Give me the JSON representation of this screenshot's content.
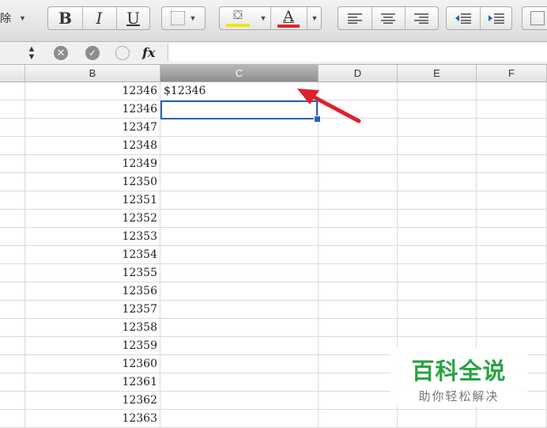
{
  "toolbar": {
    "clipped_label": "除",
    "bold_label": "B",
    "italic_label": "I",
    "underline_label": "U",
    "font_color_letter": "A",
    "fill_color_hex": "#f2e600",
    "font_color_hex": "#e0252b"
  },
  "formula_bar": {
    "fx_label": "fx",
    "content": ""
  },
  "columns": [
    "B",
    "C",
    "D",
    "E",
    "F"
  ],
  "selected_column": "C",
  "rows": [
    {
      "b": "12346",
      "c": "$12346"
    },
    {
      "b": "12346",
      "c": ""
    },
    {
      "b": "12347",
      "c": ""
    },
    {
      "b": "12348",
      "c": ""
    },
    {
      "b": "12349",
      "c": ""
    },
    {
      "b": "12350",
      "c": ""
    },
    {
      "b": "12351",
      "c": ""
    },
    {
      "b": "12352",
      "c": ""
    },
    {
      "b": "12353",
      "c": ""
    },
    {
      "b": "12354",
      "c": ""
    },
    {
      "b": "12355",
      "c": ""
    },
    {
      "b": "12356",
      "c": ""
    },
    {
      "b": "12357",
      "c": ""
    },
    {
      "b": "12358",
      "c": ""
    },
    {
      "b": "12359",
      "c": ""
    },
    {
      "b": "12360",
      "c": ""
    },
    {
      "b": "12361",
      "c": ""
    },
    {
      "b": "12362",
      "c": ""
    },
    {
      "b": "12363",
      "c": ""
    }
  ],
  "watermark": {
    "title": "百科全说",
    "subtitle": "助你轻松解决"
  }
}
